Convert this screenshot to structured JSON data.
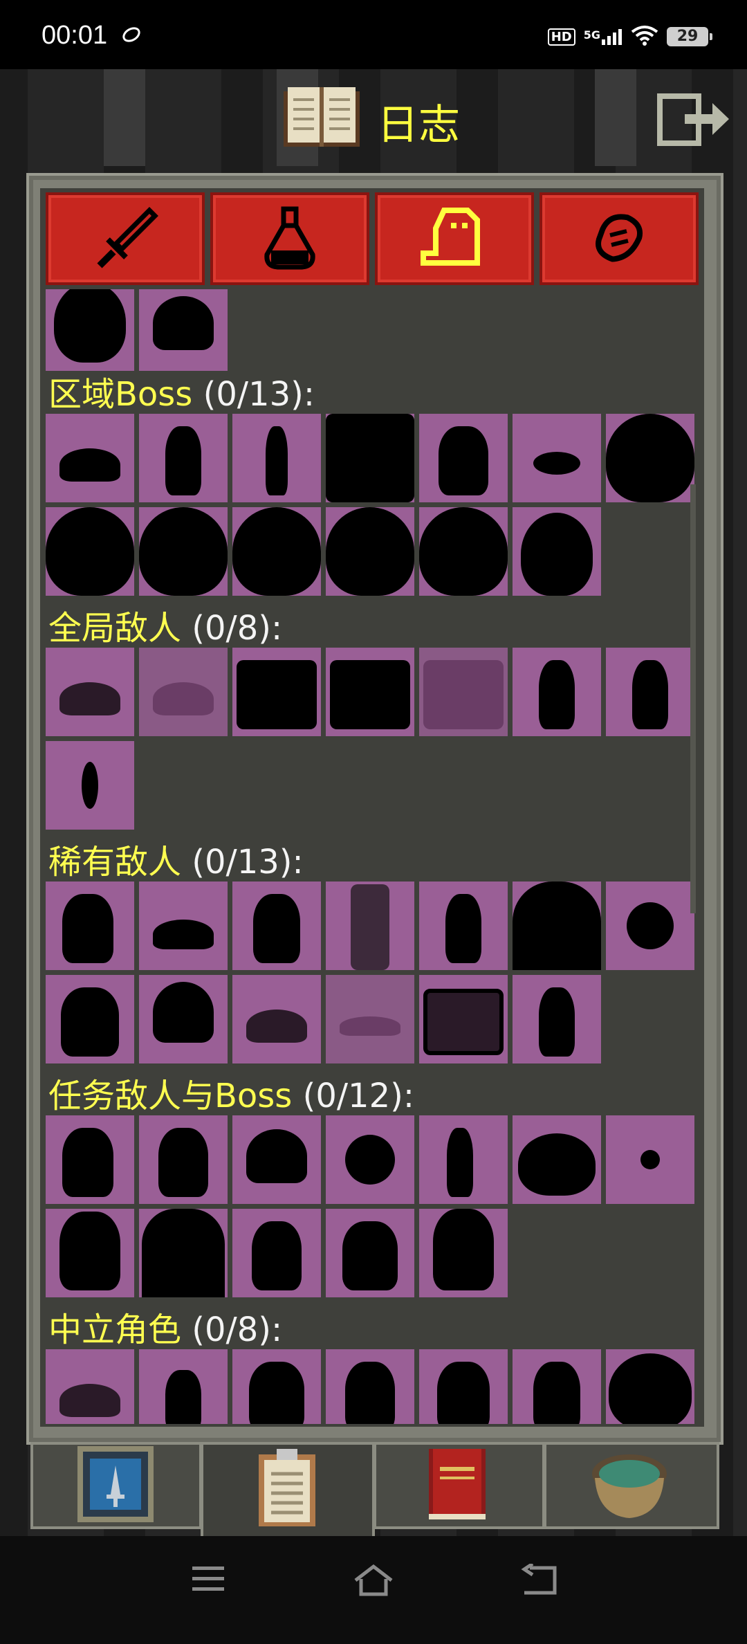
{
  "status_bar": {
    "time": "00:01",
    "network": "5G",
    "hd": "HD",
    "battery": "29"
  },
  "header": {
    "title": "日志",
    "book_icon": "open-book-icon",
    "exit_icon": "exit-icon"
  },
  "tabs": [
    {
      "icon": "sword-icon",
      "active": false
    },
    {
      "icon": "potion-icon",
      "active": false
    },
    {
      "icon": "ghost-icon",
      "active": true
    },
    {
      "icon": "scroll-icon",
      "active": false
    }
  ],
  "sections": [
    {
      "title": "区域Boss",
      "count": "(0/13):"
    },
    {
      "title": "全局敌人",
      "count": "(0/8):"
    },
    {
      "title": "稀有敌人",
      "count": "(0/13):"
    },
    {
      "title": "任务敌人与Boss",
      "count": "(0/12):"
    },
    {
      "title": "中立角色",
      "count": "(0/8):"
    }
  ],
  "bottom_tabs": [
    {
      "icon": "hero-portrait-icon"
    },
    {
      "icon": "journal-clipboard-icon",
      "active": true
    },
    {
      "icon": "red-book-icon"
    },
    {
      "icon": "alchemy-pot-icon"
    }
  ],
  "colors": {
    "accent_yellow": "#ffff50",
    "tab_red": "#c7261f",
    "cell_purple": "#9a5f96",
    "panel_bg": "#3f403b"
  }
}
